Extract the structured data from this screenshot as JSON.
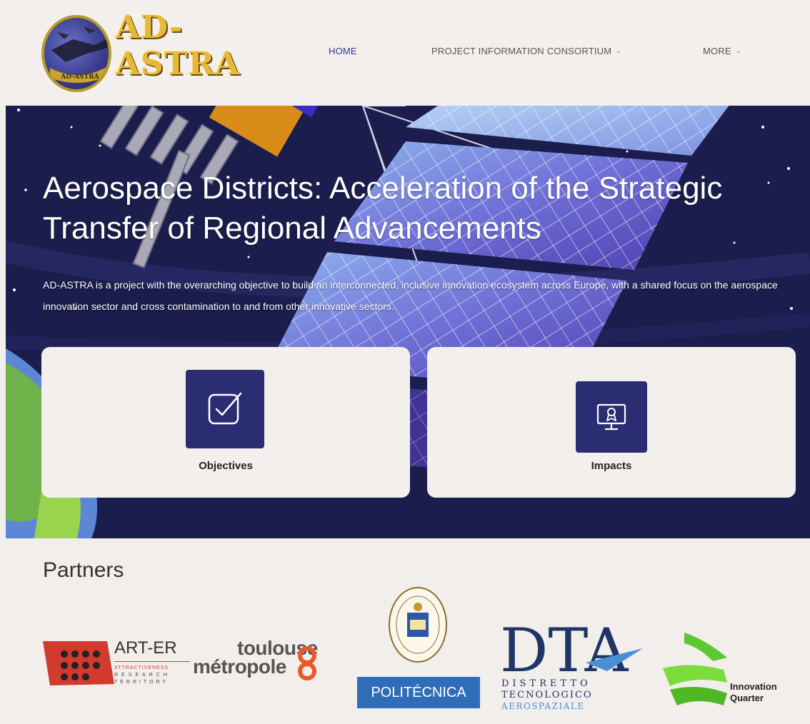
{
  "header": {
    "logo_text": "AD-ASTRA",
    "logo_badge": "AD-ASTRA",
    "nav": [
      {
        "label": "HOME",
        "active": true,
        "dropdown": false
      },
      {
        "label": "PROJECT INFORMATION CONSORTIUM",
        "active": false,
        "dropdown": true
      },
      {
        "label": "MORE",
        "active": false,
        "dropdown": true
      }
    ]
  },
  "hero": {
    "title": "Aerospace Districts: Acceleration of the Strategic Transfer of Regional Advancements",
    "description": "AD-ASTRA is a project with the overarching objective to build an interconnected, inclusive innovation ecosystem across Europe, with a shared focus on the aerospace innovation sector and cross contamination to and from other innovative sectors.",
    "cards": [
      {
        "label": "Objectives",
        "icon": "checkbox-icon"
      },
      {
        "label": "Impacts",
        "icon": "monitor-award-icon"
      }
    ]
  },
  "partners": {
    "title": "Partners",
    "logos": [
      {
        "name": "ART-ER",
        "line1": "ATTRACTIVENESS",
        "line2": "RESEARCH",
        "line3": "TERRITORY"
      },
      {
        "name": "toulouse métropole",
        "top": "toulouse",
        "bottom": "métropole"
      },
      {
        "name": "POLITÉCNICA",
        "seal": "UNIVERSIDAD POLITÉCNICA MADRID"
      },
      {
        "name": "DTA",
        "line1": "DISTRETTO",
        "line2": "TECNOLOGICO",
        "line3": "AEROSPAZIALE"
      },
      {
        "name": "Innovation Quarter",
        "line1": "Innovation",
        "line2": "Quarter"
      }
    ]
  },
  "colors": {
    "primary": "#2f3b8d",
    "card_icon_bg": "#2a2d72",
    "hero_bg": "#1b1d4d",
    "page_bg": "#f2eeec",
    "logo_gold": "#e6b93a"
  }
}
